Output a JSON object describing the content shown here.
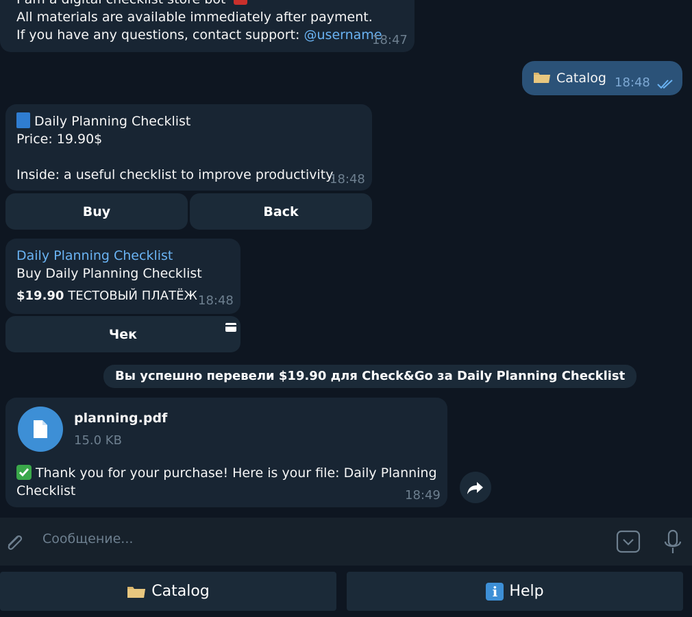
{
  "messages": {
    "welcome": {
      "line1": "I am a digital checklist store bot",
      "line2": "All materials are available immediately after payment.",
      "line3_prefix": "If you have any questions, contact support: ",
      "support_link": "@username",
      "time": "18:47"
    },
    "catalog_request": {
      "text": "Catalog",
      "time": "18:48"
    },
    "product": {
      "title": "Daily Planning Checklist",
      "price": "Price: 19.90$",
      "description": "Inside: a useful checklist to improve productivity.",
      "time": "18:48",
      "buttons": {
        "buy": "Buy",
        "back": "Back"
      }
    },
    "invoice": {
      "title": "Daily Planning Checklist",
      "description": "Buy Daily Planning Checklist",
      "amount": "$19.90",
      "test_label": "ТЕСТОВЫЙ ПЛАТЁЖ",
      "time": "18:48",
      "receipt_button": "Чек"
    },
    "payment_notice": "Вы успешно перевели $19.90 для Check&Go за Daily Planning Checklist",
    "file": {
      "name": "planning.pdf",
      "size": "15.0 KB",
      "caption_line1": "Thank you for your purchase! Here is your file: Daily Planning",
      "caption_line2": "Checklist",
      "time": "18:49"
    }
  },
  "composer": {
    "placeholder": "Сообщение..."
  },
  "reply_keyboard": {
    "catalog": "Catalog",
    "help": "Help"
  },
  "colors": {
    "background": "#0e1621",
    "incoming_bubble": "#182533",
    "outgoing_bubble": "#2b5278",
    "link": "#6ab3f3",
    "file_icon": "#3d8fd6",
    "checkmark": "#6ab3f3"
  }
}
